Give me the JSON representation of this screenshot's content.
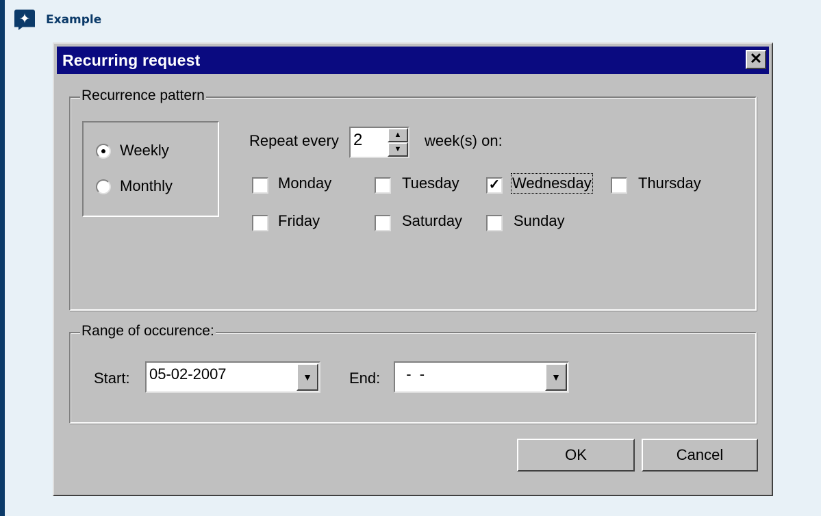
{
  "callout": {
    "title": "Example",
    "icon": "sparkle-icon"
  },
  "dialog": {
    "title": "Recurring request",
    "close_label": "✕",
    "pattern_group": {
      "label": "Recurrence pattern",
      "radios": [
        {
          "label": "Weekly",
          "checked": true
        },
        {
          "label": "Monthly",
          "checked": false
        }
      ],
      "repeat_prefix": "Repeat every",
      "repeat_value": "2",
      "repeat_suffix": "week(s) on:",
      "days": [
        {
          "label": "Monday",
          "checked": false
        },
        {
          "label": "Tuesday",
          "checked": false
        },
        {
          "label": "Wednesday",
          "checked": true
        },
        {
          "label": "Thursday",
          "checked": false
        },
        {
          "label": "Friday",
          "checked": false
        },
        {
          "label": "Saturday",
          "checked": false
        },
        {
          "label": "Sunday",
          "checked": false
        }
      ]
    },
    "range_group": {
      "label": "Range of occurence:",
      "start_label": "Start:",
      "start_value": "05-02-2007",
      "end_label": "End:",
      "end_value": "  -  -"
    },
    "ok_label": "OK",
    "cancel_label": "Cancel"
  }
}
